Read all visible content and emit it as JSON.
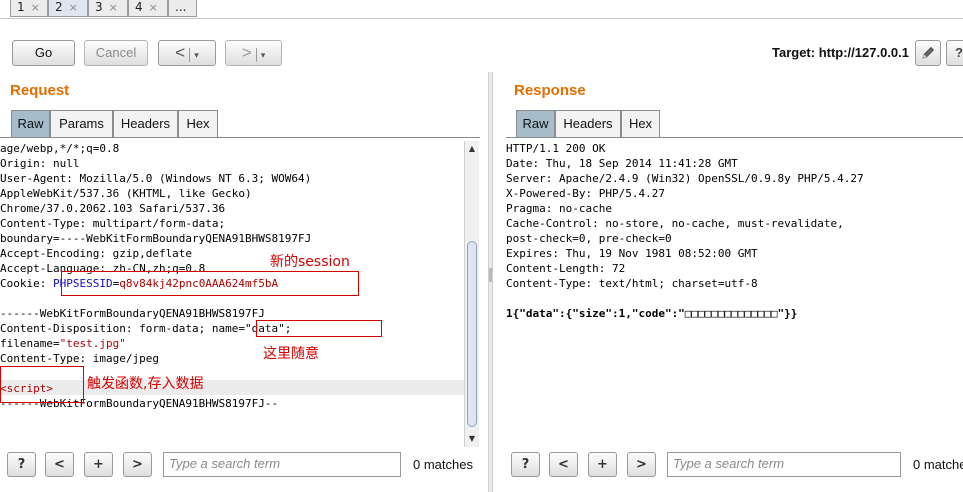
{
  "tabs": [
    {
      "label": "1",
      "close": "×"
    },
    {
      "label": "2",
      "close": "×"
    },
    {
      "label": "3",
      "close": "×"
    },
    {
      "label": "4",
      "close": "×"
    },
    {
      "label": "..."
    }
  ],
  "toolbar": {
    "go_label": "Go",
    "cancel_label": "Cancel",
    "back_arrow": "<",
    "forward_arrow": ">",
    "dropdown_glyph": "▾",
    "target_label": "Target: http://127.0.0.1",
    "edit_icon": "pencil-icon",
    "help_icon": "question-icon"
  },
  "request": {
    "title": "Request",
    "tabs": [
      "Raw",
      "Params",
      "Headers",
      "Hex"
    ],
    "lines": [
      "age/webp,*/*;q=0.8",
      "Origin: null",
      "User-Agent: Mozilla/5.0 (Windows NT 6.3; WOW64)",
      "AppleWebKit/537.36 (KHTML, like Gecko)",
      "Chrome/37.0.2062.103 Safari/537.36",
      "Content-Type: multipart/form-data;",
      "boundary=----WebKitFormBoundaryQENA91BHWS8197FJ",
      "Accept-Encoding: gzip,deflate",
      "Accept-Language: zh-CN,zh;q=0.8",
      "",
      "",
      "------WebKitFormBoundaryQENA91BHWS8197FJ",
      "",
      "",
      "Content-Type: image/jpeg",
      "",
      "",
      "------WebKitFormBoundaryQENA91BHWS8197FJ--"
    ],
    "cookie_prefix": "Cookie: ",
    "cookie_name": "PHPSESSID",
    "cookie_eq": "=",
    "cookie_value": "q8v84kj42pnc0AAA624mf5bA",
    "disposition_prefix": "Content-Disposition: form-data; ",
    "disposition_name_attr": "name=\"data\";",
    "filename_prefix": "filename=",
    "filename_value": "\"test.jpg\"",
    "script_tag": "<script>",
    "annotations": {
      "new_session": "新的session",
      "arbitrary": "这里随意",
      "trigger": "触发函数,存入数据"
    },
    "search_placeholder": "Type a search term",
    "matches": "0 matches"
  },
  "response": {
    "title": "Response",
    "tabs": [
      "Raw",
      "Headers",
      "Hex"
    ],
    "lines": [
      "HTTP/1.1 200 OK",
      "Date: Thu, 18 Sep 2014 11:41:28 GMT",
      "Server: Apache/2.4.9 (Win32) OpenSSL/0.9.8y PHP/5.4.27",
      "X-Powered-By: PHP/5.4.27",
      "Pragma: no-cache",
      "Cache-Control: no-store, no-cache, must-revalidate,",
      "post-check=0, pre-check=0",
      "Expires: Thu, 19 Nov 1981 08:52:00 GMT",
      "Content-Length: 72",
      "Content-Type: text/html; charset=utf-8",
      "",
      "1{\"data\":{\"size\":1,\"code\":\"□□□□□□□□□□□□□□\"}}"
    ],
    "search_placeholder": "Type a search term",
    "matches": "0 matche"
  },
  "search_buttons": {
    "help": "?",
    "prev": "<",
    "add": "+",
    "next": ">"
  }
}
